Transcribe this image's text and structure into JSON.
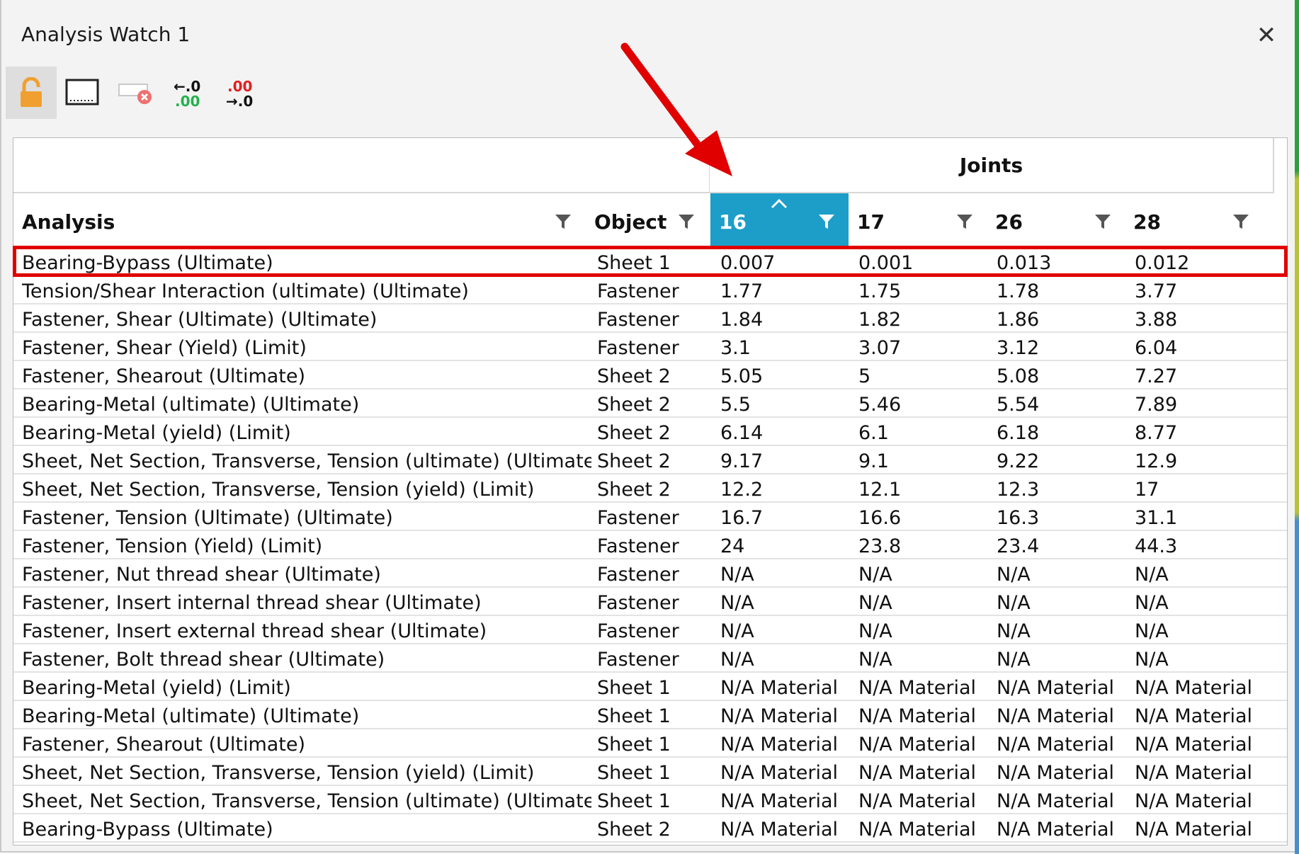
{
  "window": {
    "title": "Analysis Watch 1",
    "close_glyph": "✕"
  },
  "toolbar": {
    "buttons": [
      {
        "name": "unlock-icon"
      },
      {
        "name": "select-region-icon"
      },
      {
        "name": "clear-icon"
      },
      {
        "name": "decrease-decimals-icon",
        "top_text": "←.0",
        "bottom_text": ".00"
      },
      {
        "name": "increase-decimals-icon",
        "top_text": ".00",
        "bottom_text": "→.0"
      }
    ]
  },
  "grid": {
    "group_header": "Joints",
    "columns": [
      "Analysis",
      "Object",
      "16",
      "17",
      "26",
      "28"
    ],
    "sorted_column": "16",
    "sort_direction": "ascending",
    "highlighted_row_index": 0,
    "rows": [
      [
        "Bearing-Bypass (Ultimate)",
        "Sheet 1",
        "0.007",
        "0.001",
        "0.013",
        "0.012"
      ],
      [
        "Tension/Shear Interaction (ultimate) (Ultimate)",
        "Fastener",
        "1.77",
        "1.75",
        "1.78",
        "3.77"
      ],
      [
        "Fastener, Shear (Ultimate) (Ultimate)",
        "Fastener",
        "1.84",
        "1.82",
        "1.86",
        "3.88"
      ],
      [
        "Fastener, Shear (Yield) (Limit)",
        "Fastener",
        "3.1",
        "3.07",
        "3.12",
        "6.04"
      ],
      [
        "Fastener, Shearout (Ultimate)",
        "Sheet 2",
        "5.05",
        "5",
        "5.08",
        "7.27"
      ],
      [
        "Bearing-Metal (ultimate) (Ultimate)",
        "Sheet 2",
        "5.5",
        "5.46",
        "5.54",
        "7.89"
      ],
      [
        "Bearing-Metal (yield) (Limit)",
        "Sheet 2",
        "6.14",
        "6.1",
        "6.18",
        "8.77"
      ],
      [
        "Sheet, Net Section, Transverse, Tension (ultimate) (Ultimate)",
        "Sheet 2",
        "9.17",
        "9.1",
        "9.22",
        "12.9"
      ],
      [
        "Sheet, Net Section, Transverse, Tension (yield) (Limit)",
        "Sheet 2",
        "12.2",
        "12.1",
        "12.3",
        "17"
      ],
      [
        "Fastener, Tension (Ultimate) (Ultimate)",
        "Fastener",
        "16.7",
        "16.6",
        "16.3",
        "31.1"
      ],
      [
        "Fastener, Tension (Yield) (Limit)",
        "Fastener",
        "24",
        "23.8",
        "23.4",
        "44.3"
      ],
      [
        "Fastener, Nut thread shear (Ultimate)",
        "Fastener",
        "N/A",
        "N/A",
        "N/A",
        "N/A"
      ],
      [
        "Fastener, Insert internal thread shear (Ultimate)",
        "Fastener",
        "N/A",
        "N/A",
        "N/A",
        "N/A"
      ],
      [
        "Fastener, Insert external thread shear (Ultimate)",
        "Fastener",
        "N/A",
        "N/A",
        "N/A",
        "N/A"
      ],
      [
        "Fastener, Bolt thread shear (Ultimate)",
        "Fastener",
        "N/A",
        "N/A",
        "N/A",
        "N/A"
      ],
      [
        "Bearing-Metal (yield) (Limit)",
        "Sheet 1",
        "N/A Material",
        "N/A Material",
        "N/A Material",
        "N/A Material"
      ],
      [
        "Bearing-Metal (ultimate) (Ultimate)",
        "Sheet 1",
        "N/A Material",
        "N/A Material",
        "N/A Material",
        "N/A Material"
      ],
      [
        "Fastener, Shearout (Ultimate)",
        "Sheet 1",
        "N/A Material",
        "N/A Material",
        "N/A Material",
        "N/A Material"
      ],
      [
        "Sheet, Net Section, Transverse, Tension (yield) (Limit)",
        "Sheet 1",
        "N/A Material",
        "N/A Material",
        "N/A Material",
        "N/A Material"
      ],
      [
        "Sheet, Net Section, Transverse, Tension (ultimate) (Ultimate)",
        "Sheet 1",
        "N/A Material",
        "N/A Material",
        "N/A Material",
        "N/A Material"
      ],
      [
        "Bearing-Bypass (Ultimate)",
        "Sheet 2",
        "N/A Material",
        "N/A Material",
        "N/A Material",
        "N/A Material"
      ]
    ]
  },
  "colors": {
    "sorted_header": "#1c9ec9",
    "highlight": "#e00000",
    "arrow": "#e00000",
    "lock": "#f0a030"
  }
}
